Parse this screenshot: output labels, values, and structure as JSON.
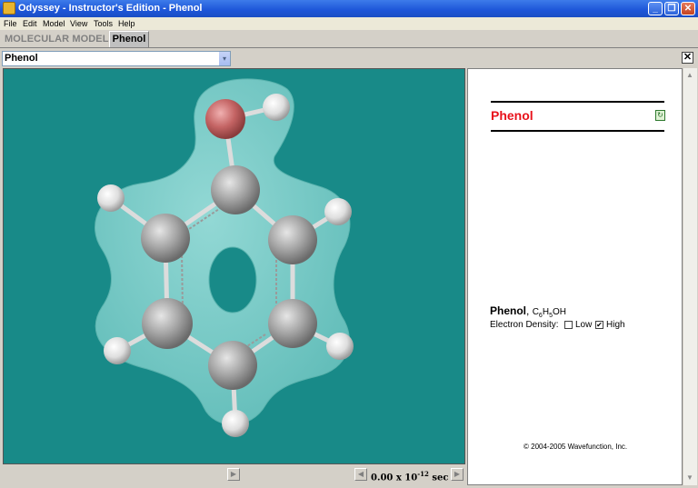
{
  "window": {
    "title": "Odyssey - Instructor's Edition - Phenol",
    "buttons": {
      "minimize": "_",
      "maximize": "❐",
      "close": "✕"
    }
  },
  "menu": [
    "File",
    "Edit",
    "Model",
    "View",
    "Tools",
    "Help"
  ],
  "tabs": [
    {
      "label": "MOLECULAR MODELS",
      "active": false
    },
    {
      "label": "Phenol",
      "active": true
    }
  ],
  "dropdown": {
    "selected": "Phenol",
    "arrow": "▾"
  },
  "close_pane": "✕",
  "viewer": {
    "background": "#188a88",
    "surface_color": "#7fd3cf",
    "atoms": {
      "oxygen_color": "#c46464",
      "carbon_color": "#a0a0a0",
      "hydrogen_color": "#e6e6e6"
    }
  },
  "controls": {
    "play": "▶",
    "step_back": "◀",
    "step_forward": "▶",
    "time_value": "0.00 x 10",
    "time_exponent": "-12",
    "time_unit": "sec"
  },
  "info": {
    "title": "Phenol",
    "title_color": "#e8121b",
    "refresh_icon": "↻",
    "mol_name": "Phenol",
    "formula_c": "C",
    "formula_c_sub": "6",
    "formula_h": "H",
    "formula_h_sub": "5",
    "formula_oh": "OH",
    "density_label": "Electron Density:",
    "low_label": "Low",
    "low_checked": false,
    "high_label": "High",
    "high_checked": true,
    "check_mark": "✔",
    "copyright": "© 2004-2005  Wavefunction, Inc."
  },
  "scroll": {
    "up": "▲",
    "down": "▼"
  }
}
